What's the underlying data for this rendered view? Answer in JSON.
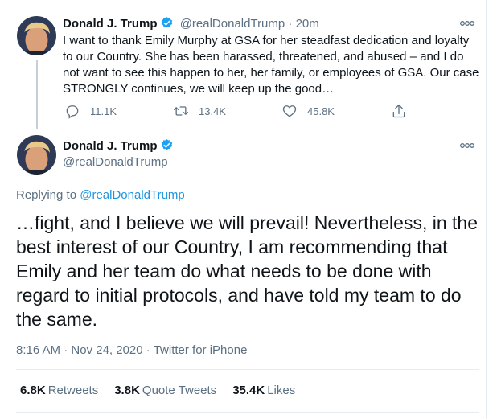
{
  "first_tweet": {
    "author_name": "Donald J. Trump",
    "handle": "@realDonaldTrump",
    "separator": "·",
    "time_ago": "20m",
    "text": "I want to thank Emily Murphy at GSA for her steadfast dedication and loyalty to our Country. She has been harassed, threatened, and abused – and I do not want to see this happen to her, her family, or employees of GSA. Our case STRONGLY continues, we will keep up the good…",
    "actions": {
      "replies": "11.1K",
      "retweets": "13.4K",
      "likes": "45.8K"
    }
  },
  "main_tweet": {
    "author_name": "Donald J. Trump",
    "handle": "@realDonaldTrump",
    "replying_to_label": "Replying to",
    "replying_to_handle": "@realDonaldTrump",
    "text": "…fight, and I believe we will prevail! Nevertheless, in the best interest of our Country, I am recommending that Emily and her team do what needs to be done with regard to initial protocols, and have told my team to do the same.",
    "time": "8:16 AM",
    "separator": "·",
    "date": "Nov 24, 2020",
    "source": "Twitter for iPhone"
  },
  "stats": {
    "retweets_count": "6.8K",
    "retweets_label": "Retweets",
    "quotes_count": "3.8K",
    "quotes_label": "Quote Tweets",
    "likes_count": "35.4K",
    "likes_label": "Likes"
  },
  "colors": {
    "accent": "#1b95e0",
    "text": "#0f1419",
    "secondary": "#5b7083",
    "verified": "#1da1f2"
  }
}
